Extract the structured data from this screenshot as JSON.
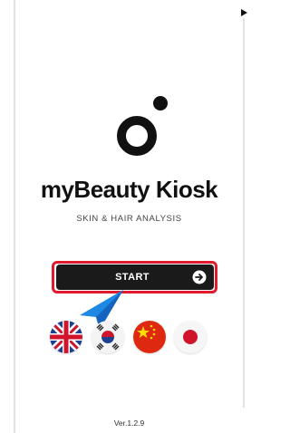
{
  "app": {
    "title": "myBeauty Kiosk",
    "subtitle": "SKIN & HAIR ANALYSIS",
    "version": "Ver.1.2.9"
  },
  "start_button": {
    "label": "START",
    "icon": "arrow-right-circle-icon",
    "highlighted": true
  },
  "languages": [
    {
      "name": "english",
      "icon": "uk-flag-icon"
    },
    {
      "name": "korean",
      "icon": "korea-flag-icon"
    },
    {
      "name": "chinese",
      "icon": "china-flag-icon"
    },
    {
      "name": "japanese",
      "icon": "japan-flag-icon"
    }
  ],
  "colors": {
    "accent_highlight": "#e01b2e",
    "button_bg": "#1a1a1a",
    "pointer": "#1e88e5"
  }
}
